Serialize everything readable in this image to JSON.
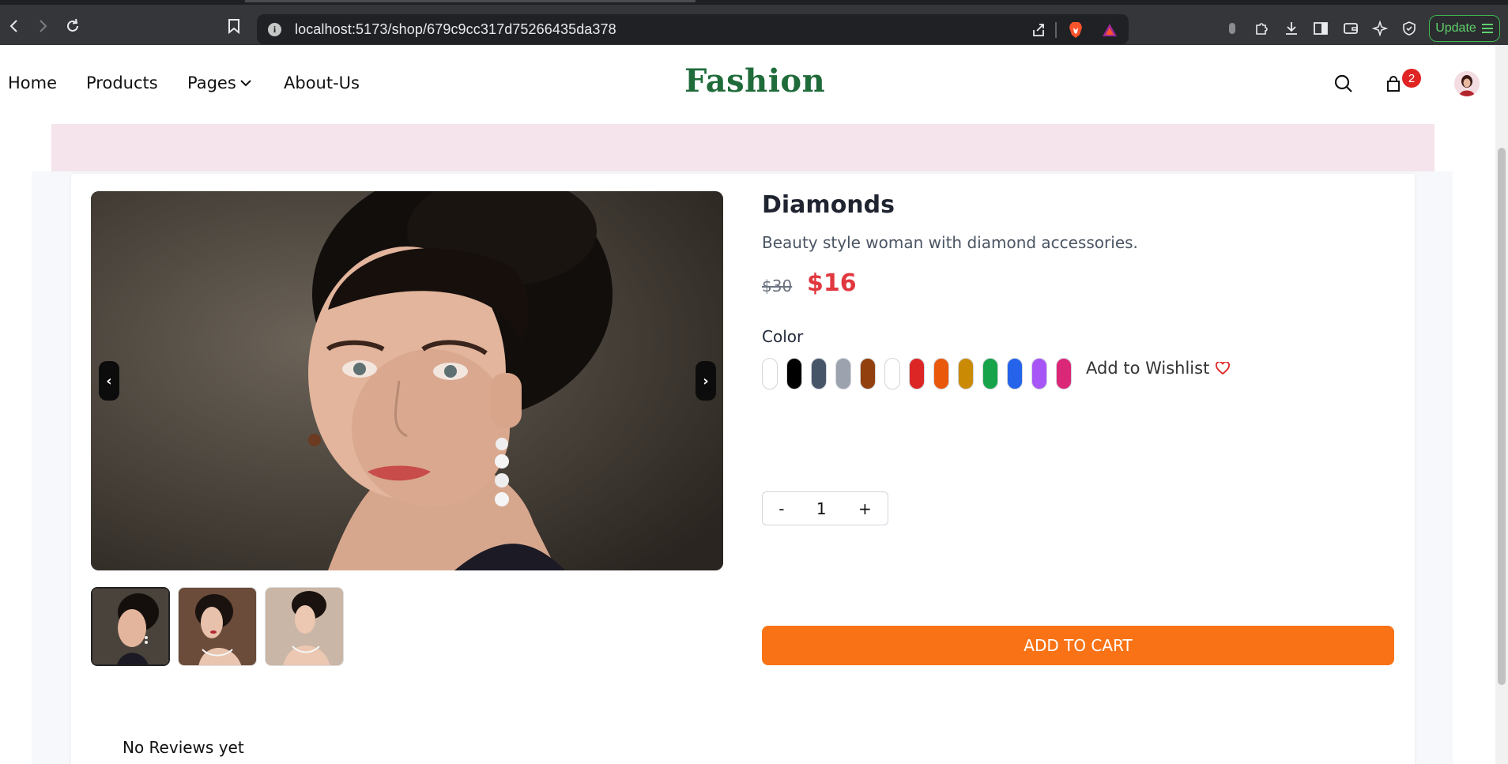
{
  "browser": {
    "url": "localhost:5173/shop/679c9cc317d75266435da378",
    "update_label": "Update",
    "icons": [
      "back-icon",
      "forward-icon",
      "reload-icon",
      "bookmark-icon",
      "info-icon",
      "share-icon",
      "brave-shield-icon",
      "brave-rewards-icon",
      "extension-icon",
      "puzzle-icon",
      "download-icon",
      "sidebar-icon",
      "wallet-icon",
      "leo-ai-icon",
      "vpn-icon",
      "menu-icon"
    ]
  },
  "header": {
    "nav": [
      "Home",
      "Products",
      "Pages",
      "About-Us"
    ],
    "brand": "Fashion",
    "cart_count": "2",
    "icons": [
      "search-icon",
      "bag-icon",
      "avatar"
    ]
  },
  "product": {
    "title": "Diamonds",
    "description": "Beauty style woman with diamond accessories.",
    "old_price": "$30",
    "price": "$16",
    "color_label": "Color",
    "colors": [
      "#ffffff",
      "#000000",
      "#475569",
      "#9ca3af",
      "#92400e",
      "#ffffff",
      "#dc2626",
      "#ea580c",
      "#ca8a04",
      "#16a34a",
      "#2563eb",
      "#a855f7",
      "#db2777"
    ],
    "wishlist_label": "Add to Wishlist",
    "qty_minus": "-",
    "qty_value": "1",
    "qty_plus": "+",
    "add_to_cart": "ADD TO CART",
    "prev_arrow": "‹",
    "next_arrow": "›"
  },
  "reviews": {
    "empty_text": "No Reviews yet"
  },
  "colors": {
    "brand": "#1f6b3a",
    "accent": "#f97316",
    "price": "#e0383e",
    "badge": "#e02424",
    "banner": "#f5e4ec"
  }
}
